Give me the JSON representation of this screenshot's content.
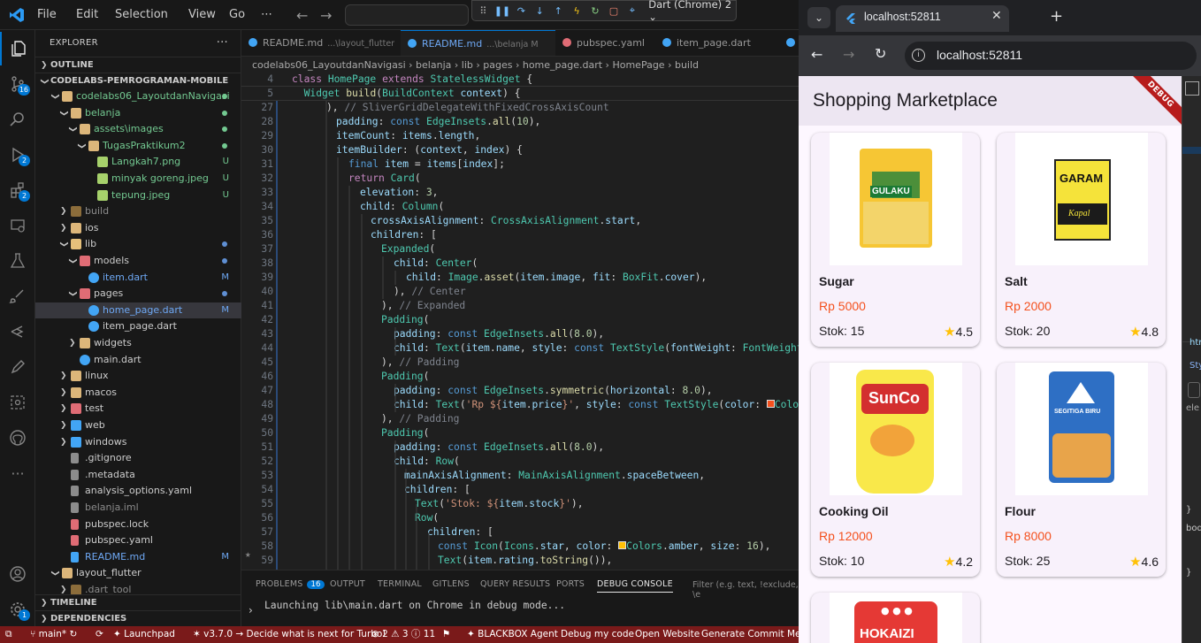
{
  "titlebar": {
    "menus": [
      "File",
      "Edit",
      "Selection",
      "View",
      "Go",
      "⋯"
    ],
    "debug_target": "Dart (Chrome) 2"
  },
  "activity": {
    "badge_scm": "16",
    "badge_debug": "2",
    "badge_ext": "2",
    "badge_accounts": "1"
  },
  "explorer": {
    "title": "EXPLORER",
    "outline": "OUTLINE",
    "root": "CODELABS-PEMROGRAMAN-MOBILE",
    "tree": [
      {
        "label": "codelabs06_LayoutdanNavigasi",
        "indent": 1,
        "type": "open",
        "color": "#73c991",
        "dot": "#73c991"
      },
      {
        "label": "belanja",
        "indent": 2,
        "type": "open",
        "color": "#73c991",
        "dot": "#73c991"
      },
      {
        "label": "assets\\images",
        "indent": 3,
        "type": "open",
        "color": "#73c991",
        "dot": "#73c991"
      },
      {
        "label": "TugasPraktikum2",
        "indent": 4,
        "type": "open",
        "color": "#73c991",
        "dot": "#73c991"
      },
      {
        "label": "Langkah7.png",
        "indent": 5,
        "type": "img",
        "color": "#73c991",
        "status": "U"
      },
      {
        "label": "minyak goreng.jpeg",
        "indent": 5,
        "type": "img",
        "color": "#73c991",
        "status": "U"
      },
      {
        "label": "tepung.jpeg",
        "indent": 5,
        "type": "img",
        "color": "#73c991",
        "status": "U"
      },
      {
        "label": "build",
        "indent": 2,
        "type": "closed",
        "color": "#8b8b8b"
      },
      {
        "label": "ios",
        "indent": 2,
        "type": "closed",
        "color": "#ccc"
      },
      {
        "label": "lib",
        "indent": 2,
        "type": "open",
        "color": "#ccc",
        "dot": "#5f8fd3"
      },
      {
        "label": "models",
        "indent": 3,
        "type": "open",
        "color": "#ccc",
        "dot": "#5f8fd3"
      },
      {
        "label": "item.dart",
        "indent": 4,
        "type": "dart",
        "color": "#6ea8f4",
        "status": "M"
      },
      {
        "label": "pages",
        "indent": 3,
        "type": "open",
        "color": "#ccc",
        "dot": "#5f8fd3"
      },
      {
        "label": "home_page.dart",
        "indent": 4,
        "type": "dart",
        "color": "#6ea8f4",
        "status": "M",
        "selected": true
      },
      {
        "label": "item_page.dart",
        "indent": 4,
        "type": "dart",
        "color": "#ccc"
      },
      {
        "label": "widgets",
        "indent": 3,
        "type": "closed",
        "color": "#ccc"
      },
      {
        "label": "main.dart",
        "indent": 3,
        "type": "dart",
        "color": "#ccc"
      },
      {
        "label": "linux",
        "indent": 2,
        "type": "closed",
        "color": "#ccc"
      },
      {
        "label": "macos",
        "indent": 2,
        "type": "closed",
        "color": "#ccc"
      },
      {
        "label": "test",
        "indent": 2,
        "type": "closed",
        "color": "#ccc"
      },
      {
        "label": "web",
        "indent": 2,
        "type": "closed",
        "color": "#ccc"
      },
      {
        "label": "windows",
        "indent": 2,
        "type": "closed",
        "color": "#ccc"
      },
      {
        "label": ".gitignore",
        "indent": 2,
        "type": "file",
        "color": "#ccc"
      },
      {
        "label": ".metadata",
        "indent": 2,
        "type": "file",
        "color": "#ccc"
      },
      {
        "label": "analysis_options.yaml",
        "indent": 2,
        "type": "file",
        "color": "#ccc"
      },
      {
        "label": "belanja.iml",
        "indent": 2,
        "type": "file",
        "color": "#8b8b8b"
      },
      {
        "label": "pubspec.lock",
        "indent": 2,
        "type": "file",
        "color": "#ccc"
      },
      {
        "label": "pubspec.yaml",
        "indent": 2,
        "type": "file",
        "color": "#ccc"
      },
      {
        "label": "README.md",
        "indent": 2,
        "type": "file",
        "color": "#6ea8f4",
        "status": "M"
      },
      {
        "label": "layout_flutter",
        "indent": 1,
        "type": "open",
        "color": "#ccc"
      },
      {
        "label": ".dart_tool",
        "indent": 2,
        "type": "closed",
        "color": "#8b8b8b"
      }
    ],
    "timeline": "TIMELINE",
    "dependencies": "DEPENDENCIES"
  },
  "tabs": [
    {
      "label": "README.md",
      "sub": "...\\layout_flutter",
      "color": "#999"
    },
    {
      "label": "README.md",
      "sub": "...\\belanja  M",
      "color": "#6ea8f4",
      "active": true
    },
    {
      "label": "pubspec.yaml",
      "sub": "",
      "color": "#999"
    },
    {
      "label": "item_page.dart",
      "sub": "",
      "color": "#999"
    },
    {
      "label": "ite",
      "sub": "",
      "color": "#999"
    }
  ],
  "breadcrumb": "codelabs06_LayoutdanNavigasi  ›  belanja  ›  lib  ›  pages  ›  home_page.dart  ›  HomePage  ›  build",
  "panel": {
    "tabs": [
      "PROBLEMS",
      "OUTPUT",
      "TERMINAL",
      "GITLENS",
      "QUERY RESULTS",
      "PORTS",
      "DEBUG CONSOLE"
    ],
    "problems_count": "16",
    "filter": "Filter (e.g. text, !exclude, \\e",
    "console": "Launching lib\\main.dart on Chrome in debug mode..."
  },
  "statusbar": {
    "branch": "main*",
    "launchpad": "Launchpad",
    "turbo": "v3.7.0 → Decide what is next for Turbo!",
    "errors": "⊗ 2 ⚠ 3 ⓘ 11",
    "blackbox": "BLACKBOX Agent",
    "debugcode": "Debug my code",
    "openweb": "Open Website",
    "commit": "Generate Commit Messa"
  },
  "browser": {
    "tab_title": "localhost:52811",
    "url": "localhost:52811"
  },
  "app": {
    "title": "Shopping Marketplace",
    "debug_label": "DEBUG",
    "items": [
      {
        "name": "Sugar",
        "price": "Rp 5000",
        "stock": "Stok: 15",
        "rating": "4.5",
        "img": "sugar"
      },
      {
        "name": "Salt",
        "price": "Rp 2000",
        "stock": "Stok: 20",
        "rating": "4.8",
        "img": "salt"
      },
      {
        "name": "Cooking Oil",
        "price": "Rp 12000",
        "stock": "Stok: 10",
        "rating": "4.2",
        "img": "oil"
      },
      {
        "name": "Flour",
        "price": "Rp 8000",
        "stock": "Stok: 25",
        "rating": "4.6",
        "img": "flour"
      }
    ],
    "product_labels": {
      "sugar": "GULAKU",
      "salt": "GARAM",
      "salt_sub": "Kapal",
      "oil": "SunCo",
      "flour": "SEGITIGA BIRU",
      "rice": "HOKAIZI"
    }
  }
}
